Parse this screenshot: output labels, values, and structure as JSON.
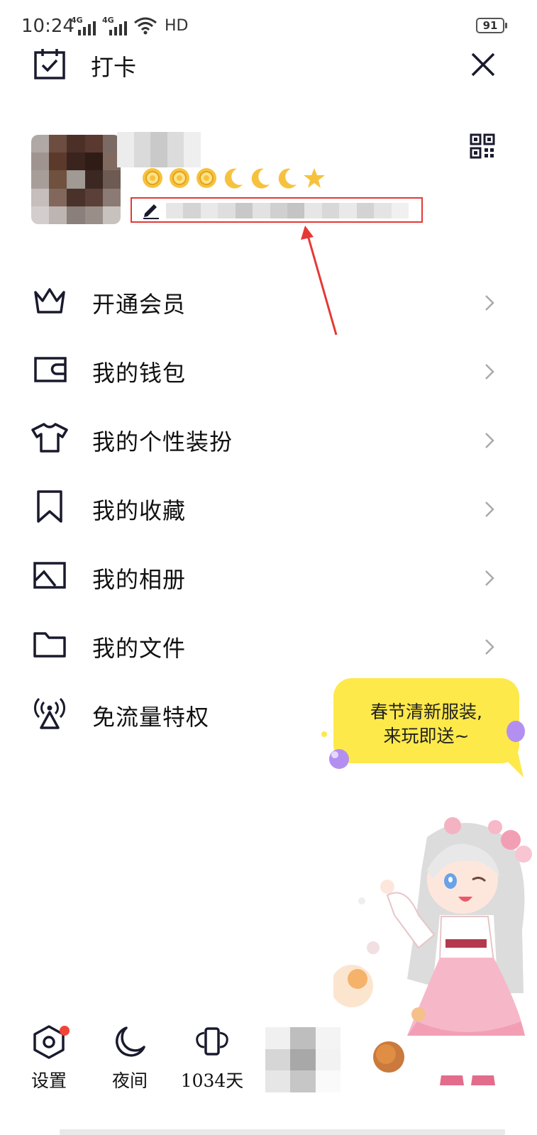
{
  "status_bar": {
    "time": "10:24",
    "network_1": "4G",
    "network_2": "4G",
    "hd": "HD",
    "battery": "91"
  },
  "header": {
    "checkin_label": "打卡"
  },
  "menu": {
    "items": [
      {
        "label": "开通会员",
        "icon": "crown-icon",
        "chevron": true
      },
      {
        "label": "我的钱包",
        "icon": "wallet-icon",
        "chevron": true
      },
      {
        "label": "我的个性装扮",
        "icon": "tshirt-icon",
        "chevron": true
      },
      {
        "label": "我的收藏",
        "icon": "bookmark-icon",
        "chevron": true
      },
      {
        "label": "我的相册",
        "icon": "image-icon",
        "chevron": true
      },
      {
        "label": "我的文件",
        "icon": "folder-icon",
        "chevron": true
      },
      {
        "label": "免流量特权",
        "icon": "signal-tower-icon",
        "chevron": false
      }
    ]
  },
  "promo": {
    "line1": "春节清新服装,",
    "line2": "来玩即送~"
  },
  "bottom_bar": {
    "settings_label": "设置",
    "night_label": "夜间",
    "days_label": "1034天"
  },
  "colors": {
    "accent_red": "#e53935",
    "promo_yellow": "#fde94a",
    "badge_red": "#f04438",
    "icon_dark": "#1a1a2e"
  }
}
